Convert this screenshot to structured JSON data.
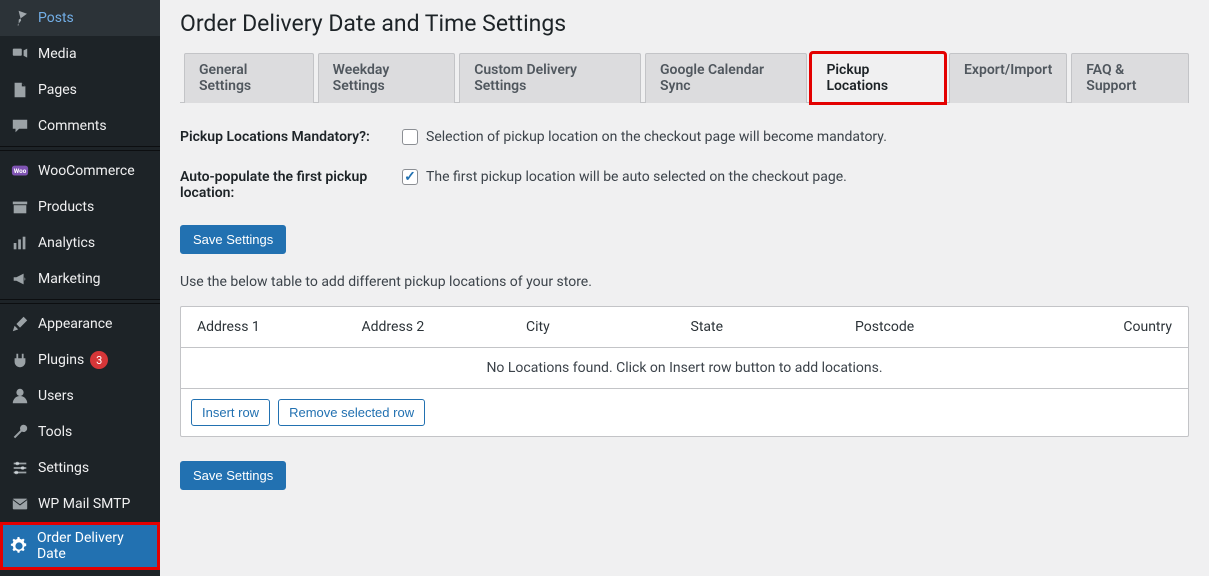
{
  "sidebar": {
    "items": [
      {
        "label": "Posts",
        "icon": "pin"
      },
      {
        "label": "Media",
        "icon": "media"
      },
      {
        "label": "Pages",
        "icon": "page"
      },
      {
        "label": "Comments",
        "icon": "comment"
      },
      {
        "label": "WooCommerce",
        "icon": "woo"
      },
      {
        "label": "Products",
        "icon": "archive"
      },
      {
        "label": "Analytics",
        "icon": "chart"
      },
      {
        "label": "Marketing",
        "icon": "megaphone"
      },
      {
        "label": "Appearance",
        "icon": "brush"
      },
      {
        "label": "Plugins",
        "icon": "plugin",
        "badge": "3"
      },
      {
        "label": "Users",
        "icon": "user"
      },
      {
        "label": "Tools",
        "icon": "wrench"
      },
      {
        "label": "Settings",
        "icon": "sliders"
      },
      {
        "label": "WP Mail SMTP",
        "icon": "mail"
      },
      {
        "label": "Order Delivery Date",
        "icon": "gear",
        "active": true,
        "highlight": true
      }
    ]
  },
  "page": {
    "title": "Order Delivery Date and Time Settings"
  },
  "tabs": [
    {
      "label": "General Settings"
    },
    {
      "label": "Weekday Settings"
    },
    {
      "label": "Custom Delivery Settings"
    },
    {
      "label": "Google Calendar Sync"
    },
    {
      "label": "Pickup Locations",
      "active": true,
      "highlight": true
    },
    {
      "label": "Export/Import"
    },
    {
      "label": "FAQ & Support"
    }
  ],
  "form": {
    "mandatory": {
      "label": "Pickup Locations Mandatory?:",
      "desc": "Selection of pickup location on the checkout page will become mandatory.",
      "checked": false
    },
    "autopopulate": {
      "label": "Auto-populate the first pickup location:",
      "desc": "The first pickup location will be auto selected on the checkout page.",
      "checked": true
    },
    "save_label": "Save Settings",
    "helper": "Use the below table to add different pickup locations of your store."
  },
  "table": {
    "columns": [
      "Address 1",
      "Address 2",
      "City",
      "State",
      "Postcode",
      "Country"
    ],
    "empty": "No Locations found. Click on Insert row button to add locations.",
    "insert_label": "Insert row",
    "remove_label": "Remove selected row"
  }
}
